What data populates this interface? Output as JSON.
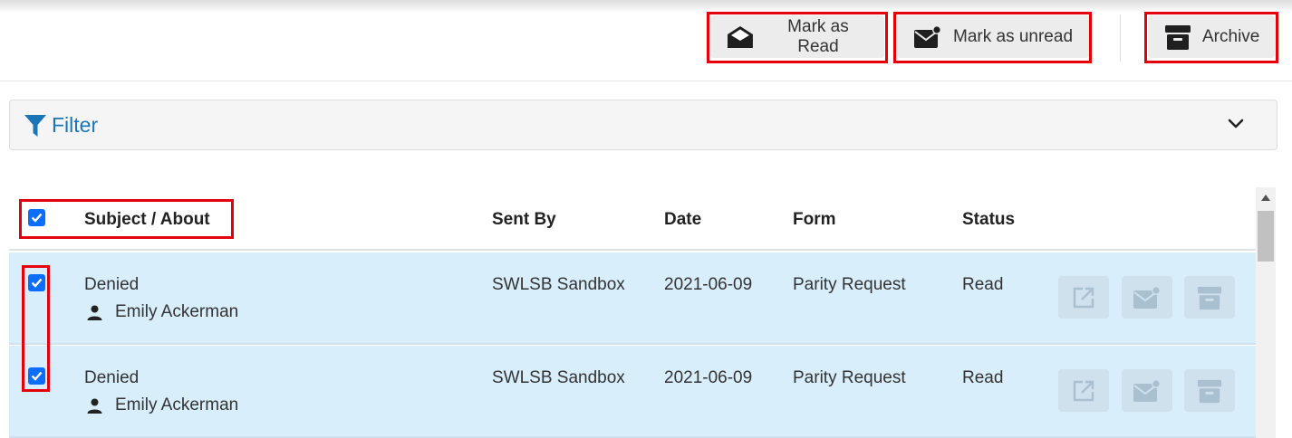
{
  "toolbar": {
    "mark_read_label": "Mark as Read",
    "mark_unread_label": "Mark as unread",
    "archive_label": "Archive"
  },
  "filter": {
    "label": "Filter"
  },
  "table": {
    "headers": {
      "subject": "Subject / About",
      "sent_by": "Sent By",
      "date": "Date",
      "form": "Form",
      "status": "Status"
    },
    "select_all_checked": true,
    "rows": [
      {
        "checked": true,
        "subject": "Denied",
        "about": "Emily Ackerman",
        "sent_by": "SWLSB Sandbox",
        "date": "2021-06-09",
        "form": "Parity Request",
        "status": "Read"
      },
      {
        "checked": true,
        "subject": "Denied",
        "about": "Emily Ackerman",
        "sent_by": "SWLSB Sandbox",
        "date": "2021-06-09",
        "form": "Parity Request",
        "status": "Read"
      }
    ]
  },
  "colors": {
    "highlight": "#e4000a",
    "checkbox": "#0d6efd",
    "filter_text": "#1a76b8",
    "selected_row": "#d9eefb",
    "toolbar_button": "#ececec"
  }
}
